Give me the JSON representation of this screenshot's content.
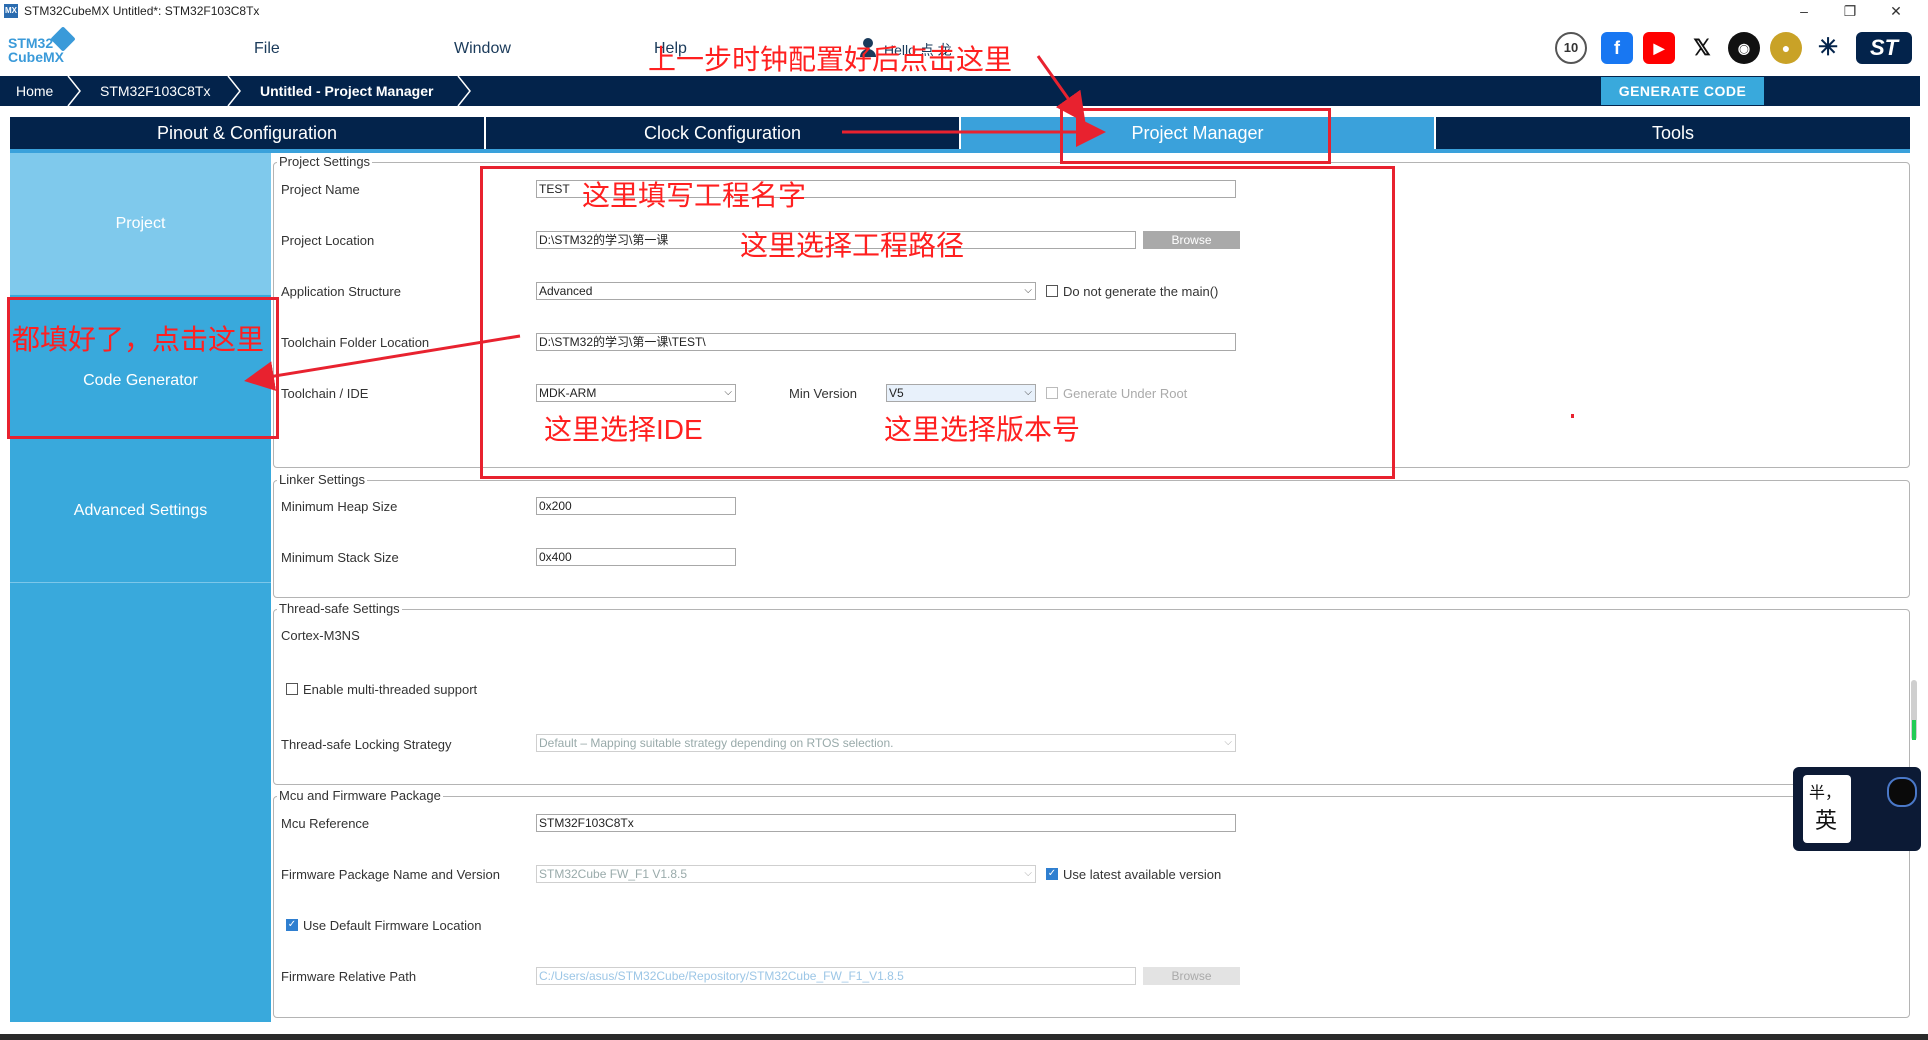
{
  "window": {
    "title": "STM32CubeMX Untitled*: STM32F103C8Tx",
    "minimize": "–",
    "maximize": "❐",
    "close": "✕"
  },
  "header": {
    "logo_top": "STM32",
    "logo_bottom": "CubeMX",
    "menu": [
      "File",
      "Window",
      "Help"
    ],
    "user": "Hello 点 龙",
    "social_icons": [
      "anniversary-10-icon",
      "facebook-icon",
      "youtube-icon",
      "x-icon",
      "github-icon",
      "community-icon",
      "network-icon",
      "st-logo-icon"
    ]
  },
  "breadcrumb": [
    "Home",
    "STM32F103C8Tx",
    "Untitled - Project Manager"
  ],
  "generate_code": "GENERATE CODE",
  "tabs": [
    {
      "label": "Pinout & Configuration",
      "active": false
    },
    {
      "label": "Clock Configuration",
      "active": false
    },
    {
      "label": "Project Manager",
      "active": true
    },
    {
      "label": "Tools",
      "active": false
    }
  ],
  "sidebar": [
    "Project",
    "Code Generator",
    "Advanced Settings"
  ],
  "project_settings": {
    "legend": "Project Settings",
    "project_name_label": "Project Name",
    "project_name": "TEST",
    "project_location_label": "Project Location",
    "project_location": "D:\\STM32的学习\\第一课",
    "browse": "Browse",
    "app_structure_label": "Application Structure",
    "app_structure": "Advanced",
    "no_main": "Do not generate the main()",
    "toolchain_folder_label": "Toolchain Folder Location",
    "toolchain_folder": "D:\\STM32的学习\\第一课\\TEST\\",
    "toolchain_ide_label": "Toolchain / IDE",
    "toolchain_ide": "MDK-ARM",
    "min_version_label": "Min Version",
    "min_version": "V5",
    "gen_under_root": "Generate Under Root"
  },
  "linker_settings": {
    "legend": "Linker Settings",
    "heap_label": "Minimum Heap Size",
    "heap": "0x200",
    "stack_label": "Minimum Stack Size",
    "stack": "0x400"
  },
  "thread_safe": {
    "legend": "Thread-safe Settings",
    "core": "Cortex-M3NS",
    "multi_thread": "Enable multi-threaded support",
    "strategy_label": "Thread-safe Locking Strategy",
    "strategy": "Default  –  Mapping suitable strategy depending on RTOS selection."
  },
  "mcu_firmware": {
    "legend": "Mcu and Firmware Package",
    "mcu_ref_label": "Mcu Reference",
    "mcu_ref": "STM32F103C8Tx",
    "fw_label": "Firmware Package Name and Version",
    "fw": "STM32Cube FW_F1 V1.8.5",
    "use_latest": "Use latest available version",
    "use_default_loc": "Use Default Firmware Location",
    "rel_path_label": "Firmware Relative Path",
    "rel_path": "C:/Users/asus/STM32Cube/Repository/STM32Cube_FW_F1_V1.8.5",
    "browse": "Browse"
  },
  "annotations": {
    "top": "上一步时钟配置好后点击这里",
    "name": "这里填写工程名字",
    "path": "这里选择工程路径",
    "done": "都填好了，点击这里",
    "ide": "这里选择IDE",
    "version": "这里选择版本号"
  },
  "ime": {
    "top": "半，",
    "bottom": "英"
  },
  "colors": {
    "navy": "#03234b",
    "accent": "#39a9dc",
    "annotation": "#e8222f"
  }
}
